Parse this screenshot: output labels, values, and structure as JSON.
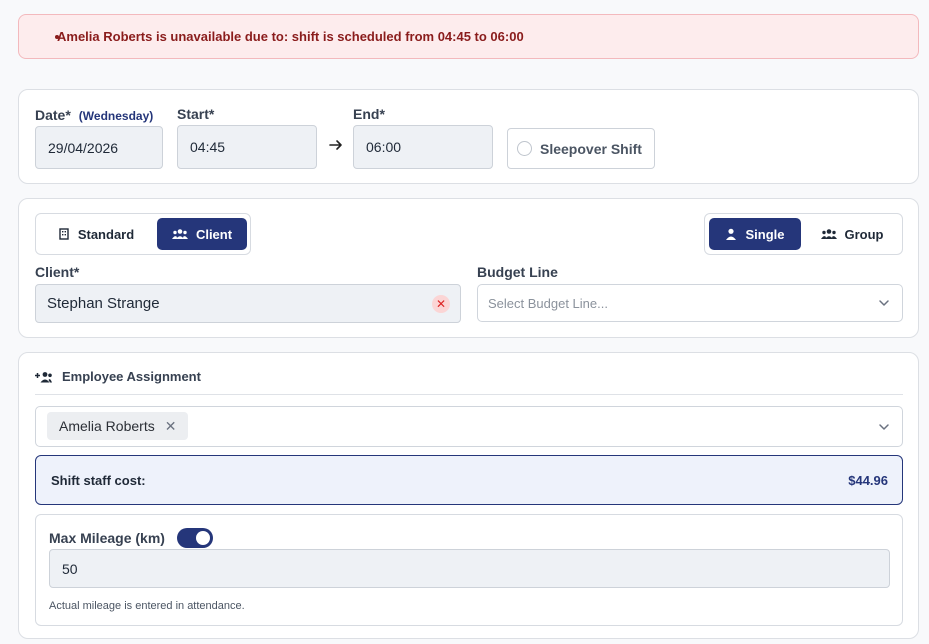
{
  "alert": {
    "message": "Amelia Roberts is unavailable due to: shift is scheduled from 04:45 to 06:00"
  },
  "datetime": {
    "date_label": "Date*",
    "day_label": "(Wednesday)",
    "date_value": "29/04/2026",
    "start_label": "Start*",
    "start_value": "04:45",
    "end_label": "End*",
    "end_value": "06:00",
    "sleepover_label": "Sleepover Shift"
  },
  "shift_type": {
    "standard_label": "Standard",
    "client_label": "Client",
    "selected": "Client"
  },
  "shift_mode": {
    "single_label": "Single",
    "group_label": "Group",
    "selected": "Single"
  },
  "client": {
    "label": "Client*",
    "value": "Stephan Strange"
  },
  "budget": {
    "label": "Budget Line",
    "placeholder": "Select Budget Line..."
  },
  "employee": {
    "section_title": "Employee Assignment",
    "selected": [
      "Amelia Roberts"
    ]
  },
  "cost": {
    "label": "Shift staff cost:",
    "amount": "$44.96"
  },
  "mileage": {
    "label": "Max Mileage (km)",
    "enabled": true,
    "value": "50",
    "hint": "Actual mileage is entered in attendance."
  },
  "colors": {
    "primary": "#25367a",
    "alert_bg": "#fdeced",
    "alert_text": "#8a1c1c",
    "cost_bg": "#eef2fb"
  }
}
